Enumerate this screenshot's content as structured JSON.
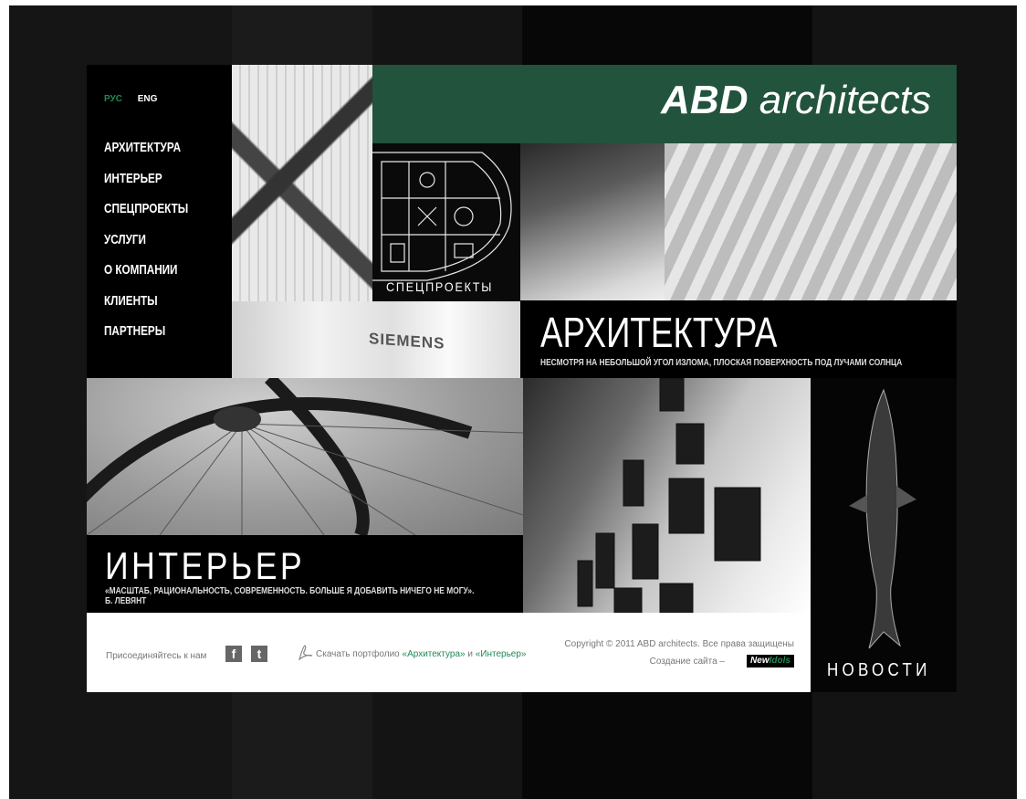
{
  "colors": {
    "brand_green": "#21533d",
    "accent_green": "#1f8a55"
  },
  "lang": {
    "ru": "РУС",
    "en": "ENG",
    "active": "ru"
  },
  "nav": {
    "items": [
      {
        "label": "АРХИТЕКТУРА"
      },
      {
        "label": "ИНТЕРЬЕР"
      },
      {
        "label": "СПЕЦПРОЕКТЫ"
      },
      {
        "label": "УСЛУГИ"
      },
      {
        "label": "О КОМПАНИИ"
      },
      {
        "label": "КЛИЕНТЫ"
      },
      {
        "label": "ПАРТНЕРЫ"
      }
    ]
  },
  "brand": {
    "bold": "ABD",
    "light": "architects"
  },
  "tiles": {
    "siemens_logo": "SIEMENS",
    "special": "СПЕЦПРОЕКТЫ",
    "architecture": {
      "title": "АРХИТЕКТУРА",
      "subtitle": "НЕСМОТРЯ НА НЕБОЛЬШОЙ УГОЛ ИЗЛОМА, ПЛОСКАЯ ПОВЕРХНОСТЬ ПОД ЛУЧАМИ СОЛНЦА"
    },
    "interior": {
      "title": "ИНТЕРЬЕР",
      "quote": "«МАСШТАБ, РАЦИОНАЛЬНОСТЬ, СОВРЕМЕННОСТЬ. БОЛЬШЕ Я ДОБАВИТЬ НИЧЕГО НЕ МОГУ».",
      "author": "Б. ЛЕВЯНТ"
    },
    "news": "НОВОСТИ"
  },
  "footer": {
    "join": "Присоединяйтесь к нам",
    "facebook": "f",
    "twitter": "t",
    "download_prefix": "Скачать портфолио",
    "link_architecture": "«Архитектура»",
    "conj": "и",
    "link_interior": "«Интерьер»",
    "copyright": "Copyright © 2011 ABD architects. Все права защищены",
    "made_by": "Создание сайта –",
    "studio_new": "New",
    "studio_idols": "Idols"
  }
}
